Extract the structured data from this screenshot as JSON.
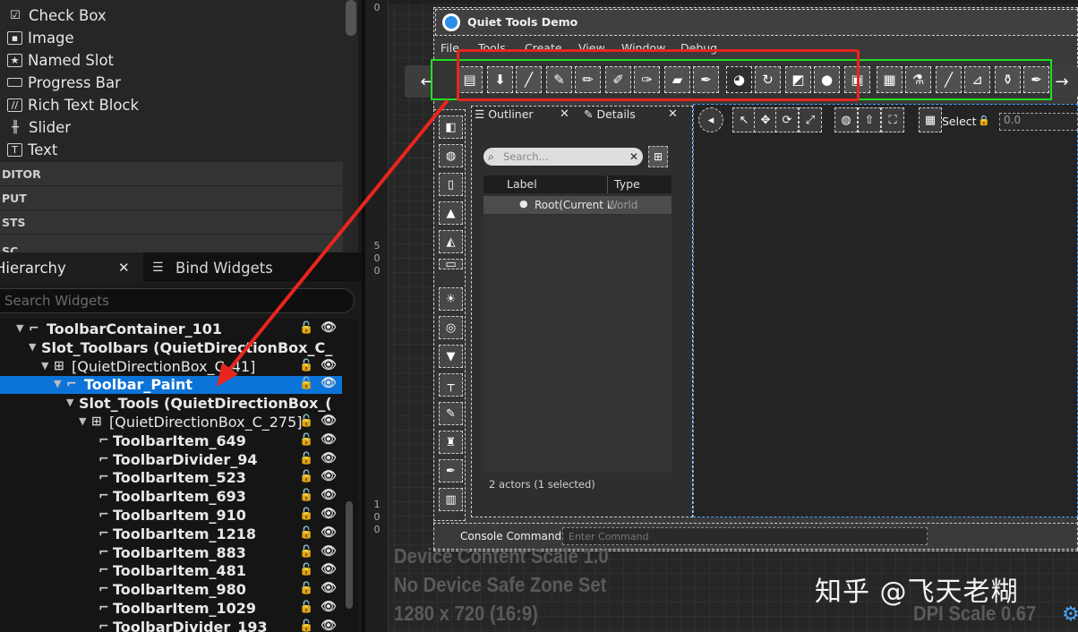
{
  "palette": {
    "items": [
      {
        "icon": "checkbox-icon",
        "label": "Check Box"
      },
      {
        "icon": "image-icon",
        "label": "Image"
      },
      {
        "icon": "named-slot-icon",
        "label": "Named Slot"
      },
      {
        "icon": "progress-bar-icon",
        "label": "Progress Bar"
      },
      {
        "icon": "rich-text-icon",
        "label": "Rich Text Block"
      },
      {
        "icon": "slider-icon",
        "label": "Slider"
      },
      {
        "icon": "text-icon",
        "label": "Text"
      }
    ],
    "categories": [
      "DITOR",
      "PUT",
      "STS",
      "SC"
    ]
  },
  "hierarchy": {
    "tab_label": "Hierarchy",
    "bind_tab_label": "Bind Widgets",
    "search_placeholder": "Search Widgets",
    "rows": [
      {
        "label": "ToolbarContainer_101",
        "indent": 0
      },
      {
        "label": "Slot_Toolbars (QuietDirectionBox_C_",
        "indent": 1
      },
      {
        "label": "[QuietDirectionBox_C_41]",
        "indent": 2
      },
      {
        "label": "Toolbar_Paint",
        "indent": 3,
        "selected": true
      },
      {
        "label": "Slot_Tools (QuietDirectionBox_(",
        "indent": 4
      },
      {
        "label": "[QuietDirectionBox_C_275]",
        "indent": 5
      },
      {
        "label": "ToolbarItem_649",
        "indent": 6
      },
      {
        "label": "ToolbarDivider_94",
        "indent": 6
      },
      {
        "label": "ToolbarItem_523",
        "indent": 6
      },
      {
        "label": "ToolbarItem_693",
        "indent": 6
      },
      {
        "label": "ToolbarItem_910",
        "indent": 6
      },
      {
        "label": "ToolbarItem_1218",
        "indent": 6
      },
      {
        "label": "ToolbarItem_883",
        "indent": 6
      },
      {
        "label": "ToolbarItem_481",
        "indent": 6
      },
      {
        "label": "ToolbarItem_980",
        "indent": 6
      },
      {
        "label": "ToolbarItem_1029",
        "indent": 6
      },
      {
        "label": "ToolbarDivider_193",
        "indent": 6
      }
    ]
  },
  "ruler": {
    "marks": [
      "0",
      "5",
      "0",
      "0",
      "1",
      "0",
      "0",
      "0"
    ]
  },
  "designer": {
    "app_title": "Quiet Tools Demo",
    "menu": [
      "File",
      "Tools",
      "Create",
      "View",
      "Window",
      "Debug"
    ],
    "nav_left": "←",
    "nav_right": "→",
    "outliner_tab": "Outliner",
    "details_tab": "Details",
    "search_placeholder": "Search...",
    "col_label": "Label",
    "col_type": "Type",
    "root_row_label": "Root(Current L",
    "root_row_type": "World",
    "footer": "2 actors (1 selected)",
    "viewport_select": "Select",
    "viewport_value": "0.0",
    "console_label": "Console Command",
    "console_placeholder": "Enter Command"
  },
  "info": {
    "content_scale": "Device Content Scale 1.0",
    "safe_zone": "No Device Safe Zone Set",
    "resolution": "1280 x 720 (16:9)",
    "dpi": "DPI Scale 0.67"
  },
  "watermark": "知乎 @飞天老糊",
  "colors": {
    "selection": "#0c74d8",
    "highlight_red": "#e8251f",
    "toolbar_green": "#21e021",
    "accent_blue": "#4aa3ff"
  }
}
